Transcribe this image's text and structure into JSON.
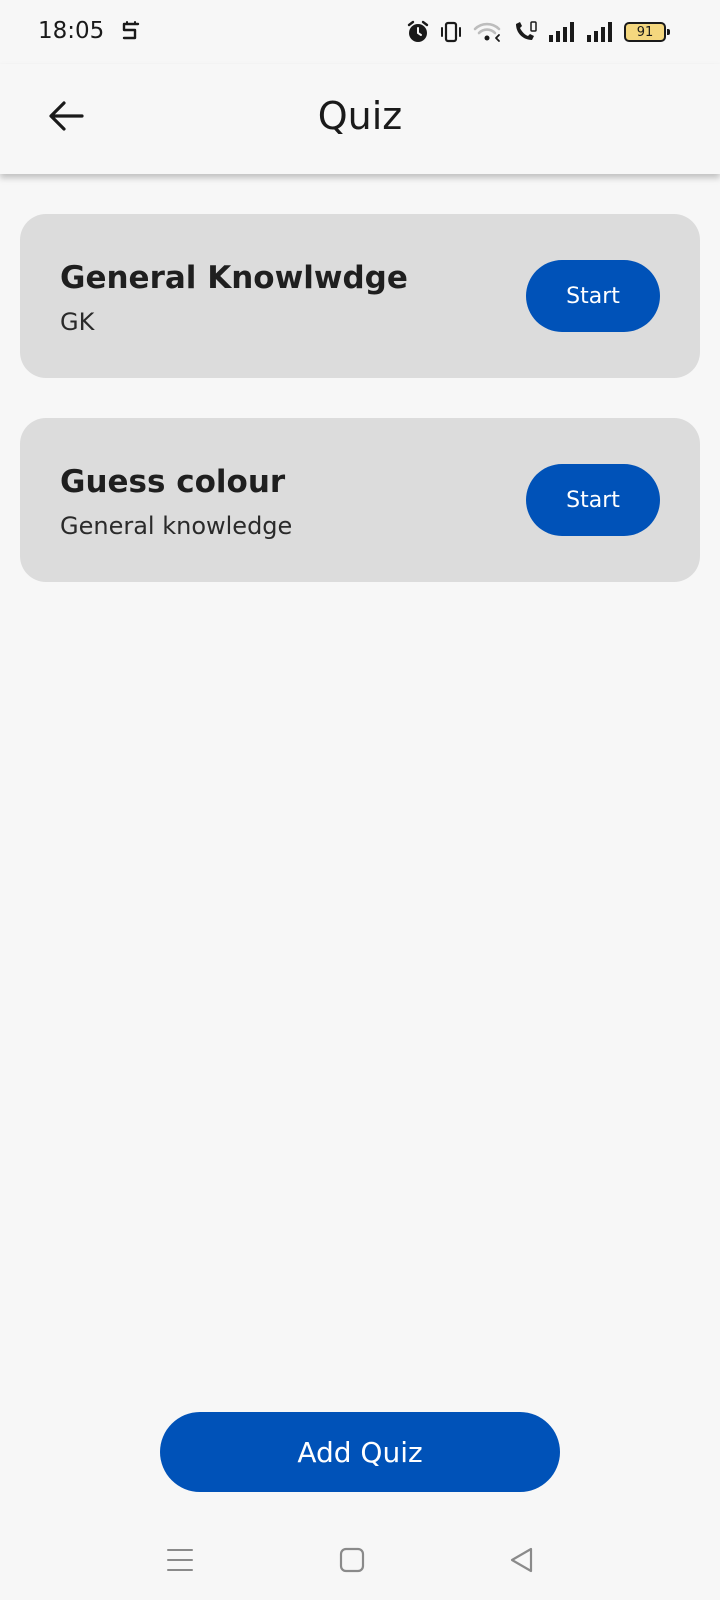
{
  "status_bar": {
    "time": "18:05",
    "battery": "91"
  },
  "app_bar": {
    "title": "Quiz"
  },
  "quizzes": [
    {
      "title": "General Knowlwdge",
      "subtitle": "GK",
      "start_label": "Start"
    },
    {
      "title": "Guess colour",
      "subtitle": "General knowledge",
      "start_label": "Start"
    }
  ],
  "add_quiz_label": "Add Quiz",
  "colors": {
    "accent": "#0052b8",
    "card": "#dcdcdc",
    "background": "#f7f7f7",
    "battery_fill": "#f4d77e"
  },
  "icons": {
    "back": "arrow-left-icon",
    "alarm": "alarm-icon",
    "vibrate": "vibrate-icon",
    "wifi": "wifi-icon",
    "call": "wifi-call-icon",
    "signal": "signal-icon",
    "menu": "menu-icon",
    "home": "home-icon",
    "back_nav": "back-triangle-icon"
  }
}
